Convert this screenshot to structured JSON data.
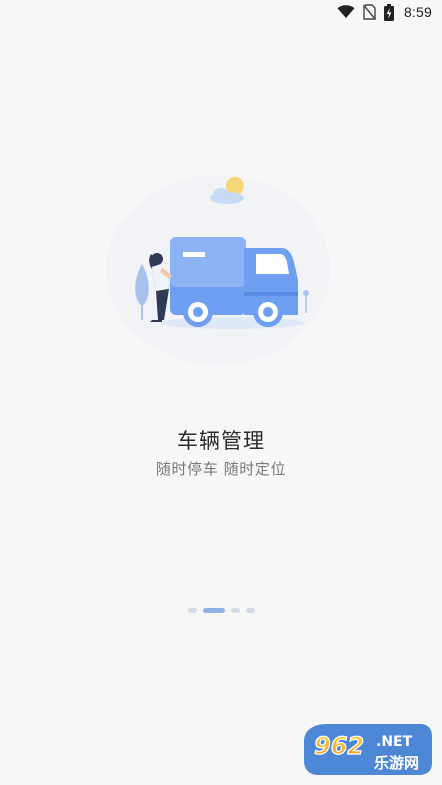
{
  "status_bar": {
    "time": "8:59",
    "icons": [
      "wifi-icon",
      "no-sim-icon",
      "battery-charging-icon"
    ]
  },
  "onboarding": {
    "illustration": "delivery-truck-illustration",
    "title": "车辆管理",
    "subtitle": "随时停车 随时定位",
    "page_count": 4,
    "active_page": 2
  },
  "watermark": {
    "number": "962",
    "domain": ".NET",
    "site": "乐游网"
  },
  "colors": {
    "background": "#f7f7f7",
    "accent": "#8fb1e6",
    "truck_blue": "#6e9ff0"
  }
}
